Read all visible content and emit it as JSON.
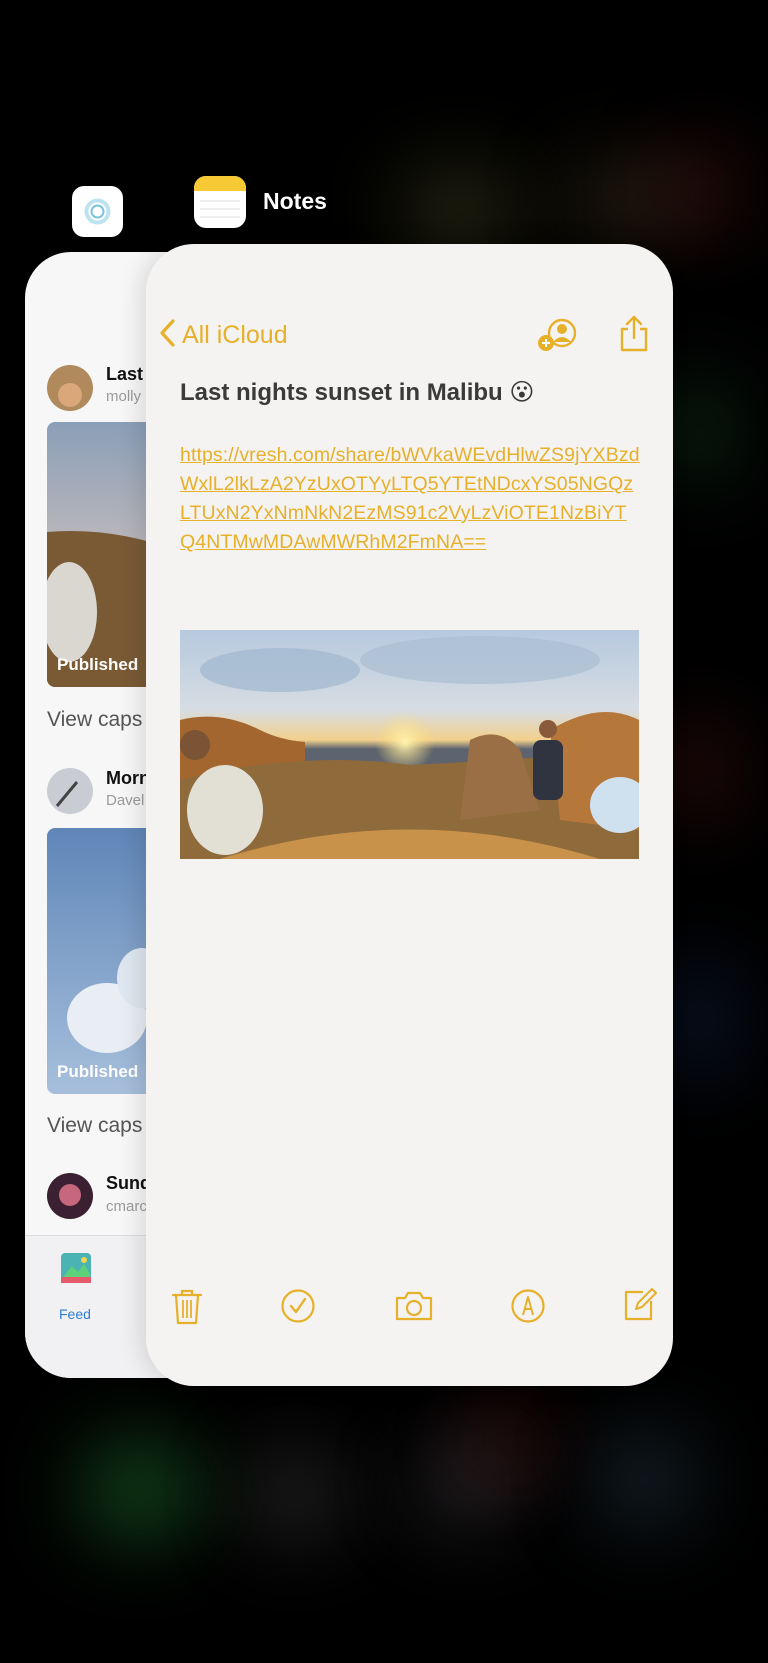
{
  "switcher": {
    "notes_app_label": "Notes"
  },
  "feed_app": {
    "posts": [
      {
        "title": "Last",
        "user": "molly",
        "status": "Published",
        "caption_link": "View caps"
      },
      {
        "title": "Morn",
        "user": "Davel",
        "status": "Published",
        "caption_link": "View caps"
      },
      {
        "title": "Sund",
        "user": "cmarc"
      }
    ],
    "tab_label": "Feed"
  },
  "notes_app": {
    "back_label": "All iCloud",
    "note_title": "Last nights sunset in Malibu 😮",
    "link_text": "https://vresh.com/share/bWVkaWEvdHlwZS9jYXBzdWxlL2lkLzA2YzUxOTYyLTQ5YTEtNDcxYS05NGQzLTUxN2YxNmNkN2EzMS91c2VyLzViOTE1NzBiYTQ4NTMwMDAwMWRhM2FmNA==",
    "toolbar": [
      "trash-icon",
      "checklist-icon",
      "camera-icon",
      "markup-icon",
      "compose-icon"
    ]
  },
  "colors": {
    "notes_accent": "#e7b02b",
    "feed_accent": "#2d7fd4",
    "background": "#000000"
  }
}
